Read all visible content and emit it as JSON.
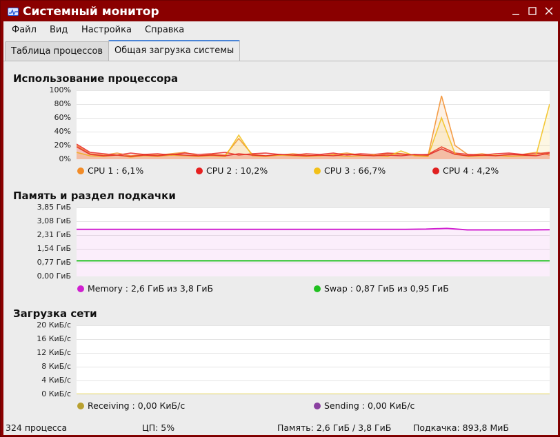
{
  "window": {
    "title": "Системный монитор"
  },
  "menu": [
    "Файл",
    "Вид",
    "Настройка",
    "Справка"
  ],
  "tabs": [
    "Таблица процессов",
    "Общая загрузка системы"
  ],
  "cpu": {
    "title": "Использование процессора",
    "y_ticks": [
      "100%",
      "80%",
      "60%",
      "40%",
      "20%",
      "0%"
    ],
    "legend": [
      {
        "label": "CPU 1 : 6,1%",
        "color": "#f28c28"
      },
      {
        "label": "CPU 2 : 10,2%",
        "color": "#e62020"
      },
      {
        "label": "CPU 3 : 66,7%",
        "color": "#f2c018"
      },
      {
        "label": "CPU 4 : 4,2%",
        "color": "#e02020"
      }
    ]
  },
  "memory": {
    "title": "Память и раздел подкачки",
    "y_ticks": [
      "3,85 ГиБ",
      "3,08 ГиБ",
      "2,31 ГиБ",
      "1,54 ГиБ",
      "0,77 ГиБ",
      "0,00 ГиБ"
    ],
    "legend": [
      {
        "label": "Memory : 2,6 ГиБ из 3,8 ГиБ",
        "color": "#d020d0"
      },
      {
        "label": "Swap : 0,87 ГиБ из 0,95 ГиБ",
        "color": "#20c020"
      }
    ]
  },
  "network": {
    "title": "Загрузка сети",
    "y_ticks": [
      "20 КиБ/с",
      "16 КиБ/с",
      "12 КиБ/с",
      "8 КиБ/с",
      "4 КиБ/с",
      "0 КиБ/с"
    ],
    "legend": [
      {
        "label": "Receiving : 0,00 КиБ/с",
        "color": "#b8a030"
      },
      {
        "label": "Sending : 0,00 КиБ/с",
        "color": "#8a40a0"
      }
    ]
  },
  "status": {
    "processes": "324 процесса",
    "cpu": "ЦП: 5%",
    "memory": "Память: 2,6 ГиБ / 3,8 ГиБ",
    "swap": "Подкачка: 893,8 МиБ"
  },
  "chart_data": [
    {
      "type": "line",
      "title": "Использование процессора",
      "ylim": [
        0,
        100
      ],
      "series": [
        {
          "name": "CPU 1",
          "values": [
            20,
            8,
            6,
            9,
            5,
            7,
            6,
            8,
            10,
            5,
            7,
            6,
            30,
            7,
            5,
            6,
            8,
            6,
            5,
            7,
            9,
            6,
            5,
            8,
            7,
            6,
            5,
            92,
            20,
            6,
            8,
            5,
            6,
            7,
            10,
            6
          ]
        },
        {
          "name": "CPU 2",
          "values": [
            22,
            10,
            8,
            6,
            9,
            7,
            8,
            6,
            9,
            7,
            8,
            10,
            6,
            8,
            9,
            7,
            6,
            8,
            7,
            9,
            6,
            8,
            7,
            9,
            8,
            6,
            7,
            18,
            9,
            7,
            6,
            8,
            9,
            7,
            8,
            10
          ]
        },
        {
          "name": "CPU 3",
          "values": [
            10,
            5,
            4,
            6,
            3,
            5,
            4,
            6,
            5,
            4,
            5,
            4,
            35,
            5,
            4,
            6,
            5,
            4,
            5,
            6,
            4,
            5,
            6,
            4,
            12,
            5,
            4,
            60,
            8,
            4,
            5,
            6,
            4,
            5,
            6,
            80
          ]
        },
        {
          "name": "CPU 4",
          "values": [
            18,
            7,
            5,
            6,
            4,
            6,
            5,
            7,
            6,
            5,
            6,
            5,
            8,
            6,
            5,
            7,
            6,
            5,
            6,
            5,
            7,
            6,
            5,
            6,
            5,
            7,
            6,
            15,
            7,
            5,
            6,
            5,
            7,
            6,
            5,
            9
          ]
        }
      ]
    },
    {
      "type": "line",
      "title": "Память и раздел подкачки",
      "ylim": [
        0,
        3.85
      ],
      "series": [
        {
          "name": "Memory",
          "values": [
            2.63,
            2.63,
            2.63,
            2.63,
            2.63,
            2.63,
            2.63,
            2.63,
            2.63,
            2.63,
            2.63,
            2.63,
            2.63,
            2.63,
            2.63,
            2.63,
            2.63,
            2.64,
            2.68,
            2.6,
            2.6,
            2.6,
            2.6,
            2.61
          ]
        },
        {
          "name": "Swap",
          "values": [
            0.87,
            0.87,
            0.87,
            0.87,
            0.87,
            0.87,
            0.87,
            0.87,
            0.87,
            0.87,
            0.87,
            0.87,
            0.87,
            0.87,
            0.87,
            0.87,
            0.87,
            0.87,
            0.87,
            0.87,
            0.87,
            0.87,
            0.87,
            0.87
          ]
        }
      ]
    },
    {
      "type": "line",
      "title": "Загрузка сети",
      "ylim": [
        0,
        20
      ],
      "series": [
        {
          "name": "Receiving",
          "values": [
            0,
            0,
            0,
            0,
            0,
            0,
            0,
            0,
            0,
            0,
            0,
            0
          ]
        },
        {
          "name": "Sending",
          "values": [
            0,
            0,
            0,
            0,
            0,
            0,
            0,
            0,
            0,
            0,
            0,
            0
          ]
        }
      ]
    }
  ]
}
